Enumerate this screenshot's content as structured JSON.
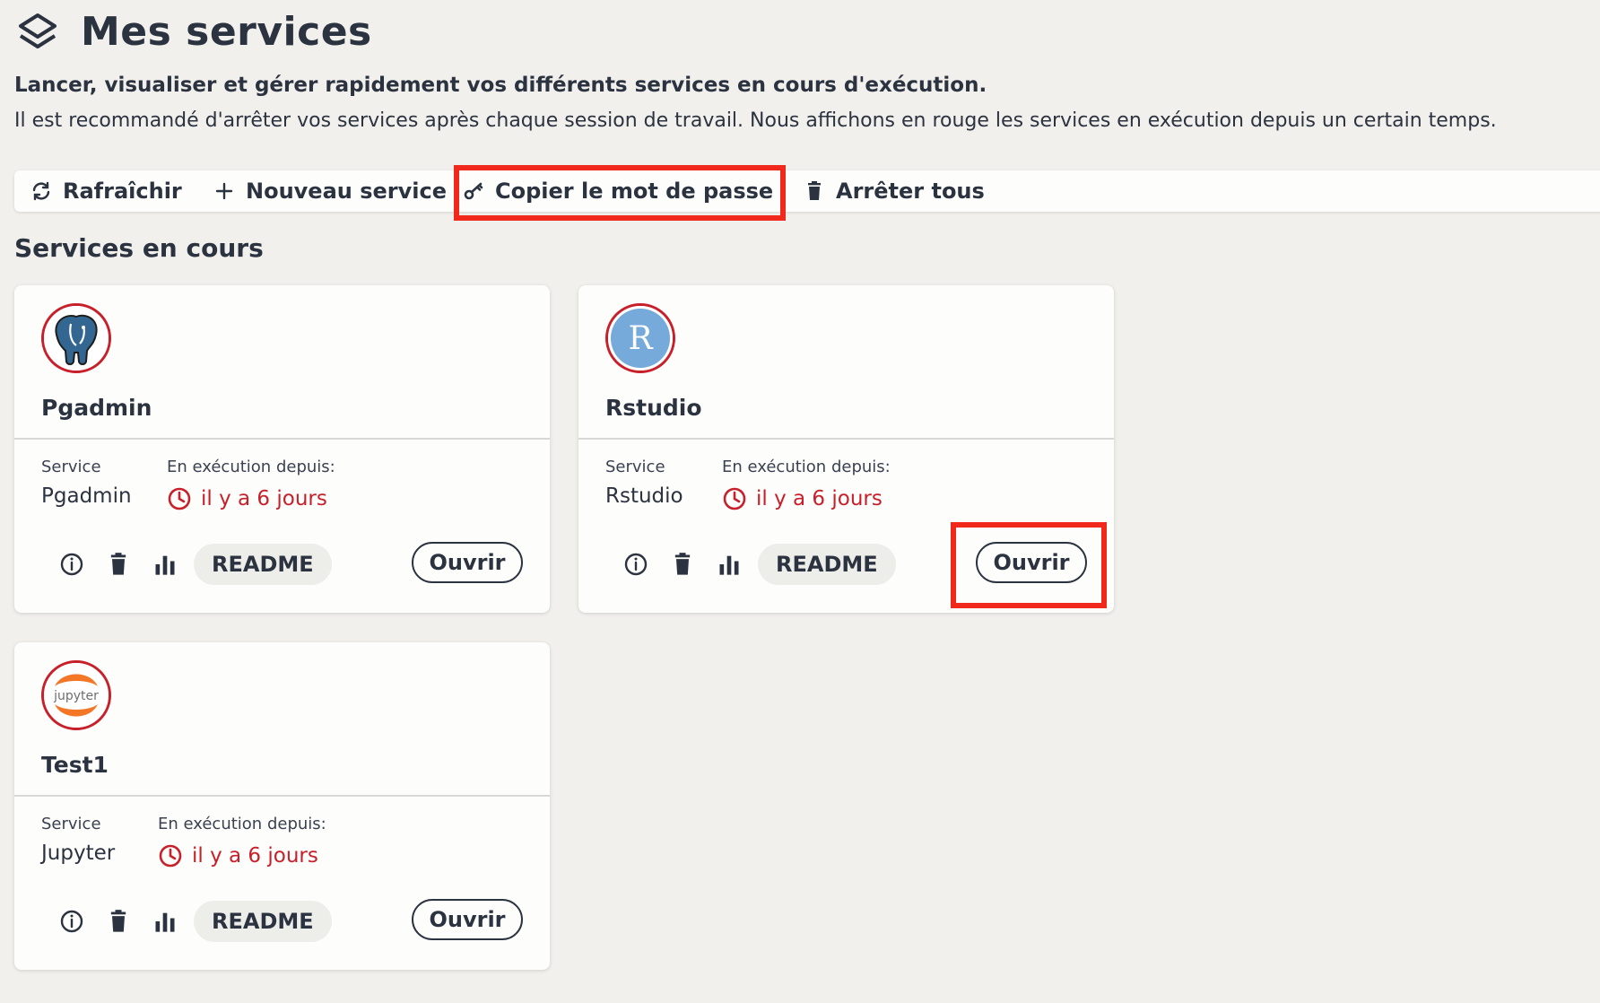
{
  "page": {
    "title": "Mes services",
    "subtitle": "Lancer, visualiser et gérer rapidement vos différents services en cours d'exécution.",
    "description": "Il est recommandé d'arrêter vos services après chaque session de travail. Nous affichons en rouge les services en exécution depuis un certain temps."
  },
  "toolbar": {
    "refresh": "Rafraîchir",
    "new_service": "Nouveau service",
    "copy_password": "Copier le mot de passe",
    "stop_all": "Arrêter tous"
  },
  "section": {
    "title": "Services en cours"
  },
  "labels": {
    "service": "Service",
    "running_since": "En exécution depuis:",
    "readme": "README",
    "open": "Ouvrir"
  },
  "logo_text": {
    "rstudio": "R",
    "jupyter": "jupyter"
  },
  "services": [
    {
      "name": "Pgadmin",
      "service_type": "Pgadmin",
      "since": "il y a 6 jours",
      "icon": "postgres-elephant-icon"
    },
    {
      "name": "Rstudio",
      "service_type": "Rstudio",
      "since": "il y a 6 jours",
      "icon": "rstudio-r-icon"
    },
    {
      "name": "Test1",
      "service_type": "Jupyter",
      "since": "il y a 6 jours",
      "icon": "jupyter-icon"
    }
  ],
  "colors": {
    "background": "#f1f0ec",
    "text": "#2c3340",
    "alert_red": "#c8202a",
    "highlight_red": "#f0291c"
  }
}
